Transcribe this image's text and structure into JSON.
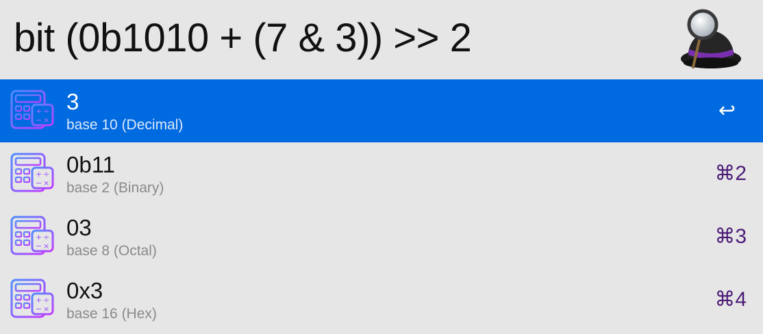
{
  "query": "bit (0b1010 + (7 & 3)) >> 2",
  "app_icon": "alfred-hat-icon",
  "results": [
    {
      "title": "3",
      "subtitle": "base 10 (Decimal)",
      "shortcut": "↩",
      "icon": "calculator-icon",
      "selected": true
    },
    {
      "title": "0b11",
      "subtitle": "base 2 (Binary)",
      "shortcut": "⌘2",
      "icon": "calculator-icon",
      "selected": false
    },
    {
      "title": "03",
      "subtitle": "base 8 (Octal)",
      "shortcut": "⌘3",
      "icon": "calculator-icon",
      "selected": false
    },
    {
      "title": "0x3",
      "subtitle": "base 16 (Hex)",
      "shortcut": "⌘4",
      "icon": "calculator-icon",
      "selected": false
    }
  ],
  "colors": {
    "background": "#e6e6e6",
    "selection": "#006ae0",
    "shortcut": "#4a1a77"
  }
}
